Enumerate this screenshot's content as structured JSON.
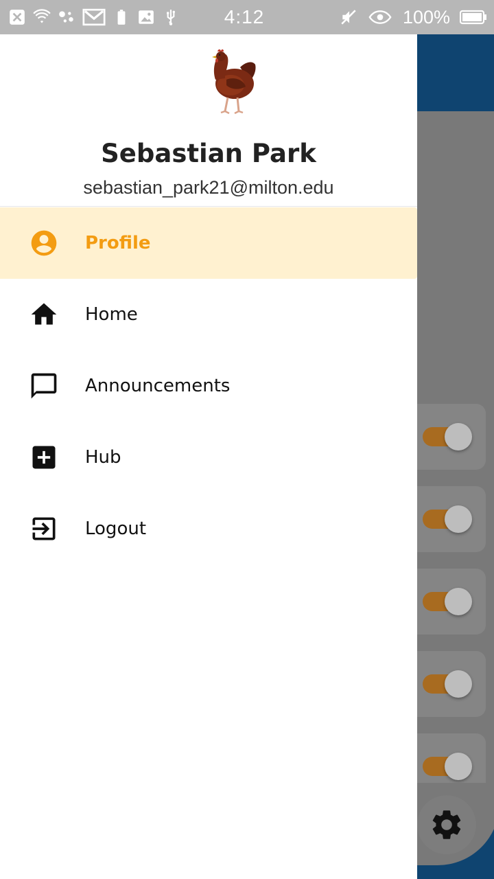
{
  "status_bar": {
    "time": "4:12",
    "battery_percent": "100%",
    "icons_left": [
      "close-box-icon",
      "wifi-icon",
      "assistant-dots-icon",
      "gmail-icon",
      "battery-small-icon",
      "image-icon",
      "usb-icon"
    ],
    "icons_right": [
      "mute-icon",
      "eye-icon",
      "battery-icon"
    ]
  },
  "drawer": {
    "user": {
      "name": "Sebastian Park",
      "email": "sebastian_park21@milton.edu",
      "avatar": "chicken-avatar"
    },
    "menu": [
      {
        "label": "Profile",
        "icon": "account-circle-icon",
        "active": true
      },
      {
        "label": "Home",
        "icon": "home-icon",
        "active": false
      },
      {
        "label": "Announcements",
        "icon": "chat-bubble-icon",
        "active": false
      },
      {
        "label": "Hub",
        "icon": "add-box-icon",
        "active": false
      },
      {
        "label": "Logout",
        "icon": "logout-icon",
        "active": false
      }
    ]
  },
  "background_app": {
    "toggle_count": 5,
    "toggles_on": [
      true,
      true,
      true,
      true,
      true
    ],
    "fab_icon": "settings-gear-icon"
  },
  "colors": {
    "active_accent": "#f39c12",
    "active_bg": "#fff1d0",
    "app_bar": "#0f4470",
    "status_bar": "#b7b7b7",
    "toggle_track": "#a86b20"
  }
}
